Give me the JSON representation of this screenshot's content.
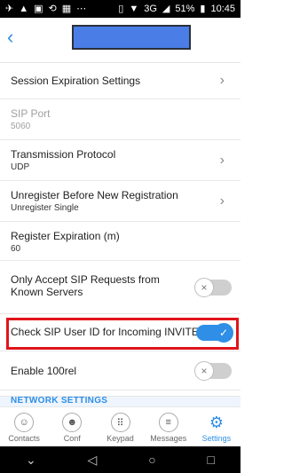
{
  "status_bar": {
    "left_icons": [
      "network-icon",
      "warning-icon",
      "image-icon",
      "sync-icon",
      "app-icon",
      "more-icon"
    ],
    "right_icons": [
      "vibrate-icon",
      "wifi-icon",
      "signal-icon"
    ],
    "network": "3G",
    "battery": "51%",
    "time": "10:45"
  },
  "header": {
    "back_icon": "chevron-left-icon",
    "title": ""
  },
  "settings": [
    {
      "label": "Session Expiration Settings",
      "sublabel": "",
      "control": "chevron",
      "enabled": true
    },
    {
      "label": "SIP Port",
      "sublabel": "5060",
      "control": "none",
      "enabled": false
    },
    {
      "label": "Transmission Protocol",
      "sublabel": "UDP",
      "control": "chevron",
      "enabled": true
    },
    {
      "label": "Unregister Before New Registration",
      "sublabel": "Unregister Single",
      "control": "chevron",
      "enabled": true
    },
    {
      "label": "Register Expiration (m)",
      "sublabel": "60",
      "control": "none",
      "enabled": true
    },
    {
      "label": "Only Accept SIP Requests from Known Servers",
      "sublabel": "",
      "control": "toggle",
      "toggle_on": false,
      "enabled": true
    },
    {
      "label": "Check SIP User ID for Incoming INVITE",
      "sublabel": "",
      "control": "toggle",
      "toggle_on": true,
      "enabled": true,
      "highlighted": true
    },
    {
      "label": "Enable 100rel",
      "sublabel": "",
      "control": "toggle",
      "toggle_on": false,
      "enabled": true
    }
  ],
  "section": {
    "title": "NETWORK SETTINGS"
  },
  "bottom_nav": [
    {
      "label": "Contacts",
      "icon": "contacts-icon",
      "active": false
    },
    {
      "label": "Conf",
      "icon": "conference-icon",
      "active": false
    },
    {
      "label": "Keypad",
      "icon": "keypad-icon",
      "active": false
    },
    {
      "label": "Messages",
      "icon": "messages-icon",
      "active": false
    },
    {
      "label": "Settings",
      "icon": "settings-gear-icon",
      "active": true
    }
  ],
  "system_nav": {
    "icons": [
      "down-chevron-icon",
      "back-triangle-icon",
      "home-circle-icon",
      "recent-square-icon"
    ]
  },
  "colors": {
    "accent": "#2f8fe6",
    "highlight_border": "#e0141a",
    "title_placeholder": "#4a7de6"
  }
}
